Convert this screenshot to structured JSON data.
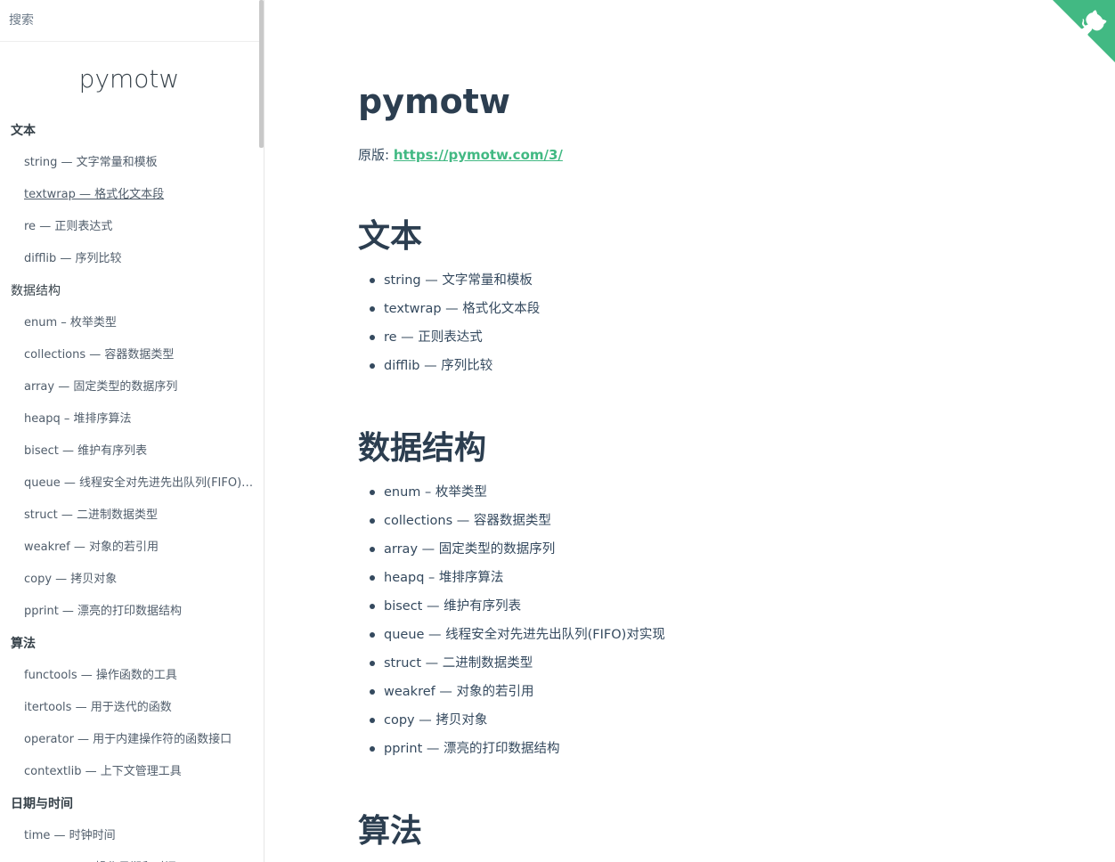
{
  "search": {
    "placeholder": "搜索"
  },
  "sidebar": {
    "app_name": "pymotw",
    "sections": [
      {
        "title": "文本",
        "bold": true,
        "items": [
          {
            "label": "string — 文字常量和模板"
          },
          {
            "label": "textwrap — 格式化文本段",
            "active": true
          },
          {
            "label": "re — 正则表达式"
          },
          {
            "label": "difflib — 序列比较"
          }
        ]
      },
      {
        "title": "数据结构",
        "bold": false,
        "items": [
          {
            "label": "enum – 枚举类型"
          },
          {
            "label": "collections — 容器数据类型"
          },
          {
            "label": "array — 固定类型的数据序列"
          },
          {
            "label": "heapq – 堆排序算法"
          },
          {
            "label": "bisect — 维护有序列表"
          },
          {
            "label": "queue — 线程安全对先进先出队列(FIFO)对实现"
          },
          {
            "label": "struct — 二进制数据类型"
          },
          {
            "label": "weakref — 对象的若引用"
          },
          {
            "label": "copy — 拷贝对象"
          },
          {
            "label": "pprint — 漂亮的打印数据结构"
          }
        ]
      },
      {
        "title": "算法",
        "bold": true,
        "items": [
          {
            "label": "functools — 操作函数的工具"
          },
          {
            "label": "itertools — 用于迭代的函数"
          },
          {
            "label": "operator — 用于内建操作符的函数接口"
          },
          {
            "label": "contextlib — 上下文管理工具"
          }
        ]
      },
      {
        "title": "日期与时间",
        "bold": true,
        "items": [
          {
            "label": "time — 时钟时间"
          },
          {
            "label": "datetime — 操作日期和时间"
          }
        ]
      }
    ]
  },
  "main": {
    "title": "pymotw",
    "source_label": "原版: ",
    "source_link": "https://pymotw.com/3/",
    "sections": [
      {
        "heading": "文本",
        "items": [
          "string — 文字常量和模板",
          "textwrap — 格式化文本段",
          "re — 正则表达式",
          "difflib — 序列比较"
        ]
      },
      {
        "heading": "数据结构",
        "items": [
          "enum – 枚举类型",
          "collections — 容器数据类型",
          "array — 固定类型的数据序列",
          "heapq – 堆排序算法",
          "bisect — 维护有序列表",
          "queue — 线程安全对先进先出队列(FIFO)对实现",
          "struct — 二进制数据类型",
          "weakref — 对象的若引用",
          "copy — 拷贝对象",
          "pprint — 漂亮的打印数据结构"
        ]
      },
      {
        "heading": "算法",
        "items": []
      }
    ]
  },
  "corner": {
    "icon": "github-octocat-icon",
    "color": "#42b983"
  },
  "colors": {
    "accent": "#42b983",
    "text": "#34495e",
    "heading": "#2c3e50"
  }
}
